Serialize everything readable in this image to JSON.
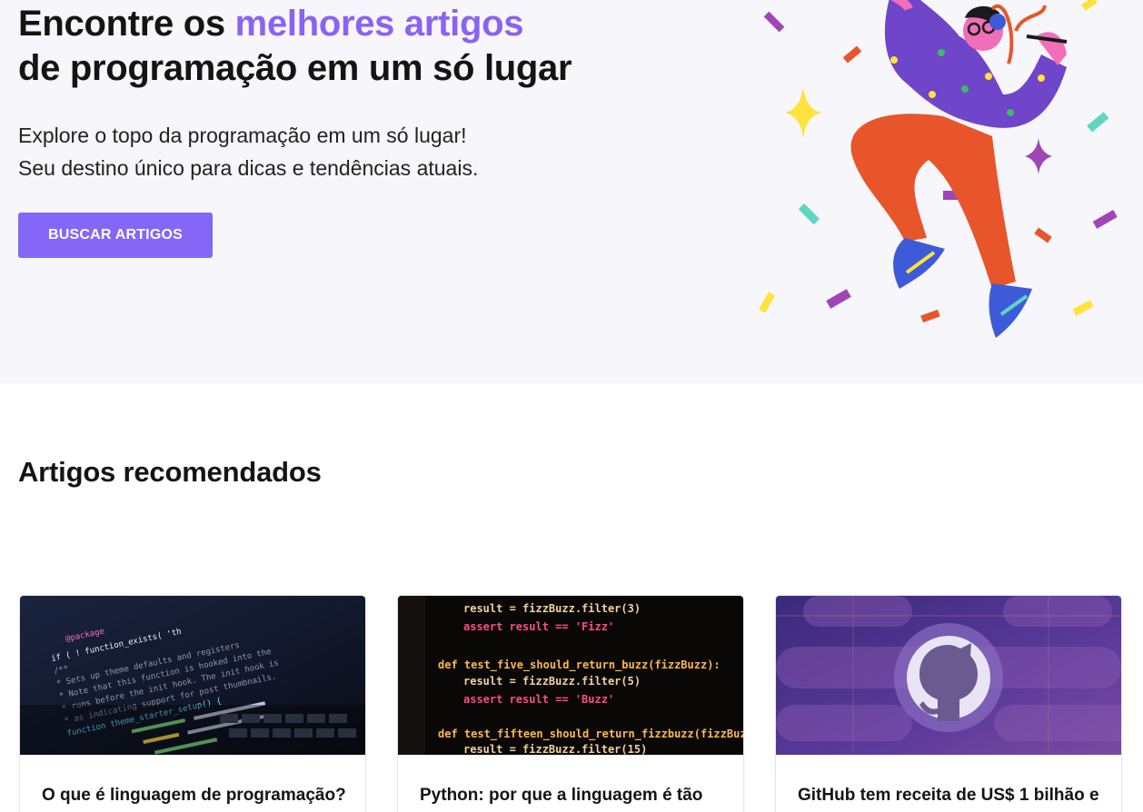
{
  "hero": {
    "title_line1_prefix": "Encontre os ",
    "title_line1_accent": "melhores artigos",
    "title_line2": "de programação em um só lugar",
    "subtitle_line1": "Explore o topo da programação em um só lugar!",
    "subtitle_line2": "Seu destino único para dicas e tendências atuais.",
    "cta_label": "BUSCAR ARTIGOS",
    "illustration_icon": "dancing-person-confetti-illustration"
  },
  "recommended": {
    "title": "Artigos recomendados",
    "cards": [
      {
        "title": "O que é linguagem de programação?",
        "image_icon": "code-on-laptop-screen-image",
        "code_lines": [
          "@package",
          "if ( ! function_exists( 'th",
          "/**",
          " * Sets up theme defaults and registers",
          " * Note that this function is hooked into the",
          " * runs before the init hook. The init hook is",
          " * as indicating support for post thumbnails.",
          "function theme_starter_setup() {"
        ]
      },
      {
        "title": "Python: por que a linguagem é tão",
        "image_icon": "python-test-code-image",
        "code_lines": [
          "result = fizzBuzz.filter(3)",
          "assert result == 'Fizz'",
          "",
          "def test_five_should_return_buzz(fizzBuzz):",
          "result = fizzBuzz.filter(5)",
          "assert result == 'Buzz'",
          "",
          "def test_fifteen_should_return_fizzbuzz(fizzBuzz):",
          "result = fizzBuzz.filter(15)"
        ]
      },
      {
        "title": "GitHub tem receita de US$ 1 bilhão e",
        "image_icon": "github-octocat-logo-image"
      }
    ]
  },
  "colors": {
    "accent": "#8a63f2",
    "button": "#8467f7",
    "hero_bg": "#f6f6fb",
    "shirt": "#6f45c9",
    "pants": "#e8552b",
    "skin": "#f06fb8"
  }
}
